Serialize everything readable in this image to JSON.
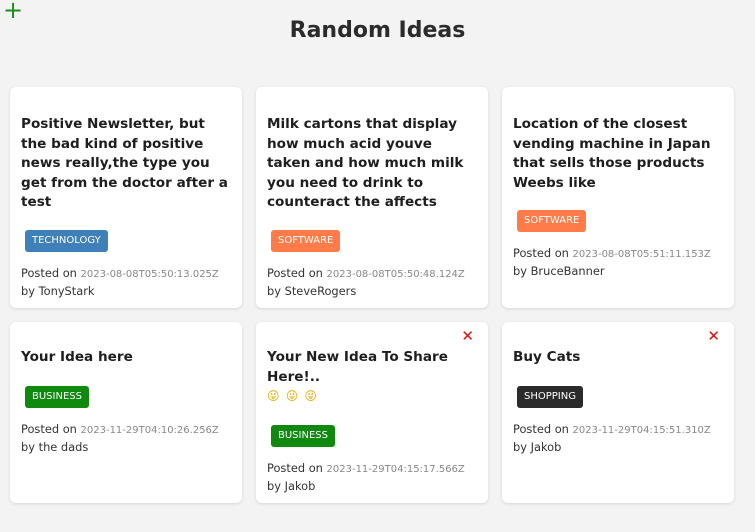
{
  "header": {
    "add_icon": "+",
    "title": "Random Ideas"
  },
  "colors": {
    "technology": "#3f80b9",
    "software": "#ff7b4a",
    "business": "#0f8a0f",
    "shopping": "#2b2b2b",
    "delete": "#e01010",
    "add": "#1a8f1a"
  },
  "ideas": [
    {
      "text": "Positive Newsletter, but the bad kind of positive news really,the type you get from the doctor after a test",
      "tag": "TECHNOLOGY",
      "posted_prefix": "Posted on",
      "date": "2023-08-08T05:50:13.025Z",
      "by": "by",
      "author": "TonyStark"
    },
    {
      "text": "Milk cartons that display how much acid youve taken and how much milk you need to drink to counteract the affects",
      "tag": "SOFTWARE",
      "posted_prefix": "Posted on",
      "date": "2023-08-08T05:50:48.124Z",
      "by": "by",
      "author": "SteveRogers"
    },
    {
      "text": "Location of the closest vending machine in Japan that sells those products Weebs like",
      "tag": "SOFTWARE",
      "posted_prefix": "Posted on",
      "date": "2023-08-08T05:51:11.153Z",
      "by": "by",
      "author": "BruceBanner"
    },
    {
      "text": "Your Idea here",
      "tag": "BUSINESS",
      "posted_prefix": "Posted on",
      "date": "2023-11-29T04:10:26.256Z",
      "by": "by",
      "author": "the dads"
    },
    {
      "text": "Your New Idea To Share Here!..",
      "emoji": "😜 😜 😜",
      "tag": "BUSINESS",
      "posted_prefix": "Posted on",
      "date": "2023-11-29T04:15:17.566Z",
      "by": "by",
      "author": "Jakob",
      "delete_icon": "✕"
    },
    {
      "text": "Buy Cats",
      "tag": "SHOPPING",
      "posted_prefix": "Posted on",
      "date": "2023-11-29T04:15:51.310Z",
      "by": "by",
      "author": "Jakob",
      "delete_icon": "✕"
    }
  ]
}
